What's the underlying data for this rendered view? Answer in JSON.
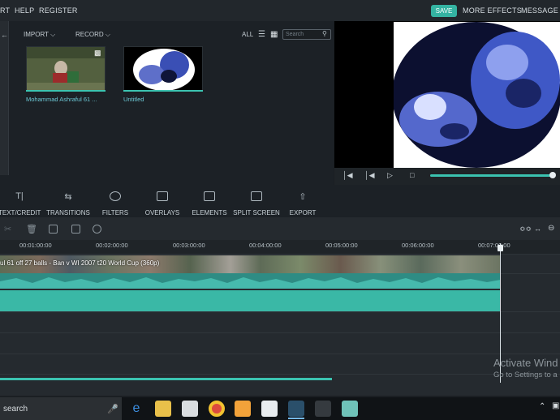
{
  "menubar": {
    "left_items": [
      "RT",
      "HELP",
      "REGISTER"
    ],
    "save_label": "SAVE",
    "more_effects_label": "MORE EFFECTS",
    "message_label": "MESSAGE"
  },
  "library": {
    "back_icon": "arrow-left-icon",
    "import_label": "IMPORT",
    "record_label": "RECORD",
    "all_label": "ALL",
    "search_placeholder": "Search",
    "items": [
      {
        "label": "Mohammad Ashraful 61 ...",
        "icon": "video-camera-icon"
      },
      {
        "label": "Untitled"
      }
    ]
  },
  "toolbar": {
    "items": [
      {
        "label": "TEXT/CREDIT",
        "icon": "text-icon"
      },
      {
        "label": "TRANSITIONS",
        "icon": "transitions-icon"
      },
      {
        "label": "FILTERS",
        "icon": "filters-icon"
      },
      {
        "label": "OVERLAYS",
        "icon": "overlays-icon"
      },
      {
        "label": "ELEMENTS",
        "icon": "elements-icon"
      },
      {
        "label": "SPLIT SCREEN",
        "icon": "split-screen-icon"
      },
      {
        "label": "EXPORT",
        "icon": "export-icon"
      }
    ]
  },
  "ruler": {
    "ticks": [
      "00:01:00:00",
      "00:02:00:00",
      "00:03:00:00",
      "00:04:00:00",
      "00:05:00:00",
      "00:06:00:00",
      "00:07:00:00"
    ]
  },
  "timeline": {
    "video_clip_title": "ul 61 off 27 balls - Ban v WI 2007 t20 World Cup (360p)"
  },
  "watermark": {
    "line1": "Activate Wind",
    "line2": "Go to Settings to a"
  },
  "taskbar": {
    "search_text": "search",
    "apps": [
      "edge-icon",
      "file-explorer-icon",
      "store-icon",
      "chrome-icon",
      "paint-icon",
      "mail-icon",
      "filmora-icon",
      "tool-icon",
      "notes-icon"
    ]
  },
  "colors": {
    "accent": "#34b3a2",
    "track_teal": "#3ab8a6"
  }
}
